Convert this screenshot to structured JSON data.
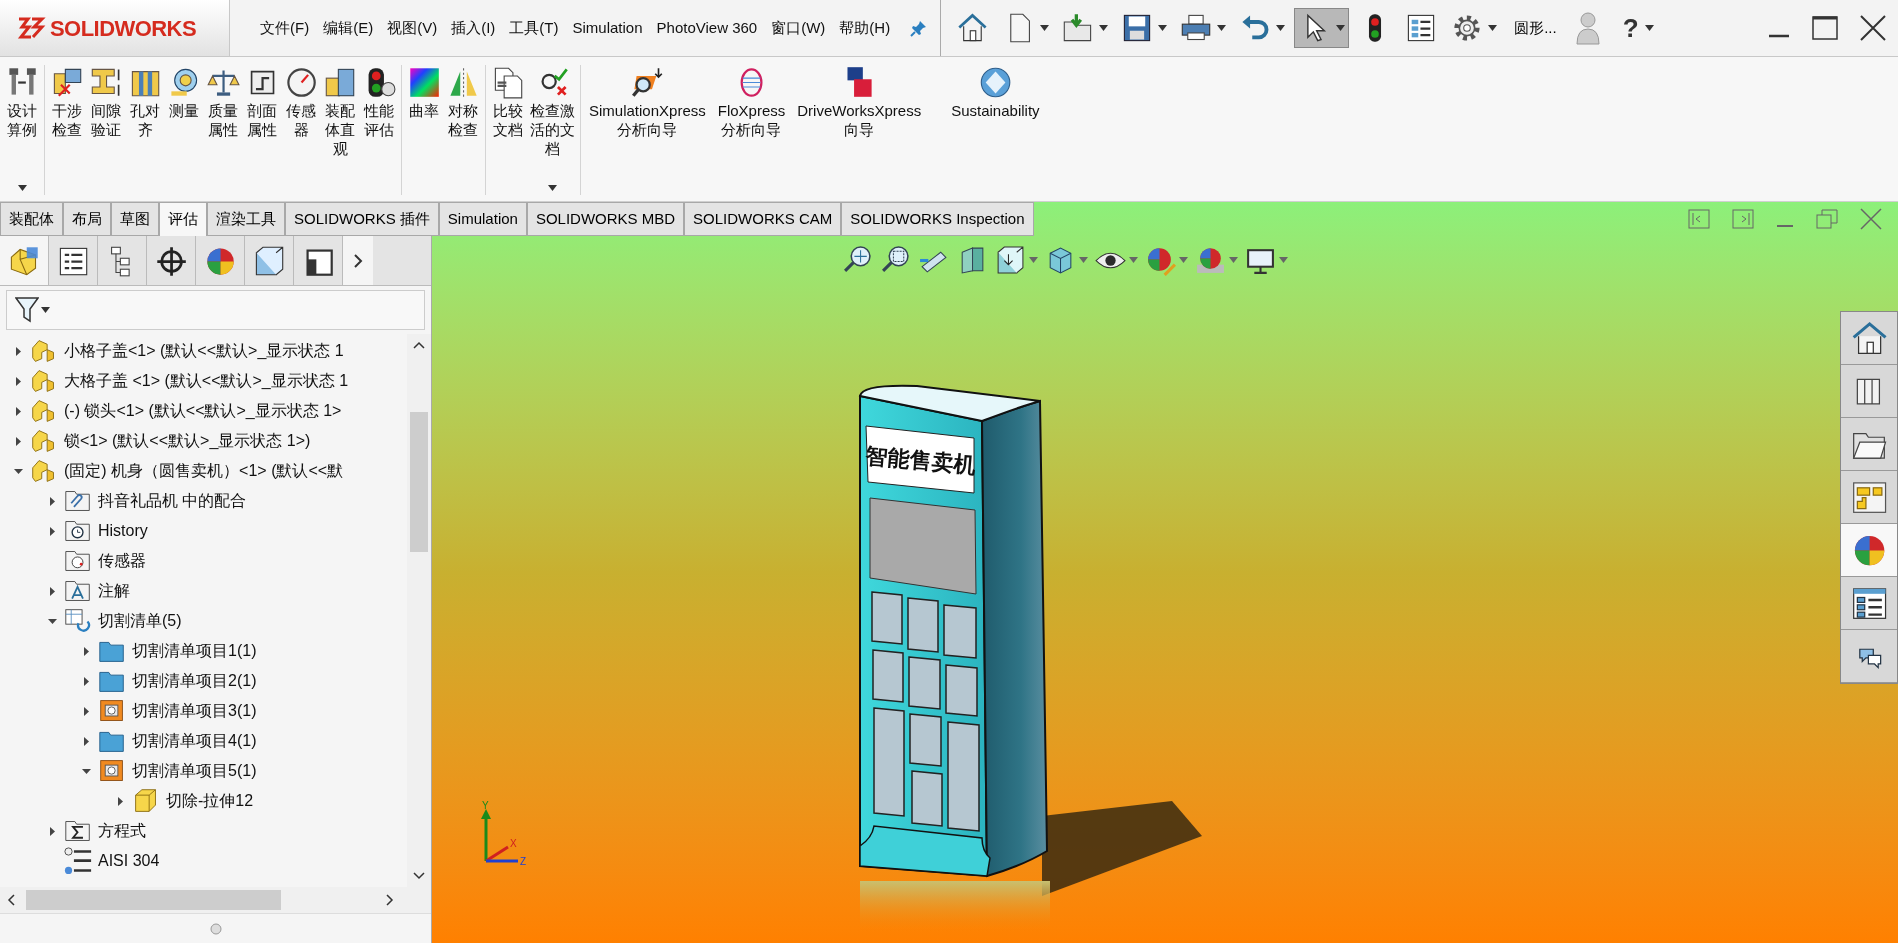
{
  "app": {
    "logo_text": "SOLIDWORKS"
  },
  "menu": [
    "文件(F)",
    "编辑(E)",
    "视图(V)",
    "插入(I)",
    "工具(T)",
    "Simulation",
    "PhotoView 360",
    "窗口(W)",
    "帮助(H)"
  ],
  "quick_tools": [
    {
      "kind": "home"
    },
    {
      "kind": "new",
      "dropdown": true
    },
    {
      "kind": "open",
      "dropdown": true
    },
    {
      "kind": "save",
      "dropdown": true
    },
    {
      "kind": "print",
      "dropdown": true
    },
    {
      "kind": "undo",
      "dropdown": true
    },
    {
      "kind": "select",
      "dropdown": true,
      "pressed": true
    },
    {
      "kind": "rebuild"
    },
    {
      "kind": "list"
    },
    {
      "kind": "options",
      "dropdown": true
    }
  ],
  "search_label": "圆形...",
  "help_label": "?",
  "ribbon_groups": [
    {
      "buttons": [
        {
          "label": "设计算例",
          "kind": "narrow",
          "dropdown": true
        }
      ]
    },
    {
      "buttons": [
        {
          "label": "干涉检查",
          "kind": "narrow"
        },
        {
          "label": "间隙验证",
          "kind": "narrow"
        },
        {
          "label": "孔对齐",
          "kind": "narrow"
        },
        {
          "label": "测量",
          "kind": "narrow"
        },
        {
          "label": "质量属性",
          "kind": "narrow"
        },
        {
          "label": "剖面属性",
          "kind": "narrow"
        },
        {
          "label": "传感器",
          "kind": "narrow"
        },
        {
          "label": "装配体直观",
          "kind": "narrow"
        },
        {
          "label": "性能评估",
          "kind": "narrow"
        }
      ]
    },
    {
      "buttons": [
        {
          "label": "曲率",
          "kind": "narrow"
        },
        {
          "label": "对称检查",
          "kind": "narrow"
        }
      ]
    },
    {
      "buttons": [
        {
          "label": "比较文档",
          "kind": "narrow"
        },
        {
          "label": "检查激活的文档",
          "kind": "wide",
          "dropdown": true
        }
      ]
    },
    {
      "buttons": [
        {
          "label": "SimulationXpress分析向导",
          "kind": "latin"
        },
        {
          "label": "FloXpress分析向导",
          "kind": "latin"
        },
        {
          "label": "DriveWorksXpress向导",
          "kind": "latin"
        },
        {
          "label": "Sustainability",
          "kind": "latin"
        }
      ]
    }
  ],
  "tabs": [
    {
      "label": "装配体",
      "selected": false
    },
    {
      "label": "布局",
      "selected": false
    },
    {
      "label": "草图",
      "selected": false
    },
    {
      "label": "评估",
      "selected": true
    },
    {
      "label": "渲染工具",
      "selected": false
    },
    {
      "label": "SOLIDWORKS 插件",
      "selected": false
    },
    {
      "label": "Simulation",
      "selected": false
    },
    {
      "label": "SOLIDWORKS MBD",
      "selected": false
    },
    {
      "label": "SOLIDWORKS CAM",
      "selected": false
    },
    {
      "label": "SOLIDWORKS Inspection",
      "selected": false
    }
  ],
  "panel_tabs": [
    {
      "selected": true
    },
    {
      "selected": false
    },
    {
      "selected": false
    },
    {
      "selected": false
    },
    {
      "selected": false
    },
    {
      "selected": false
    },
    {
      "selected": false
    }
  ],
  "tree": [
    {
      "label": "小格子盖<1> (默认<<默认>_显示状态 1",
      "kind": "part",
      "expanded": false
    },
    {
      "label": "大格子盖 <1> (默认<<默认>_显示状态 1",
      "kind": "part",
      "expanded": false
    },
    {
      "label": "(-) 锁头<1> (默认<<默认>_显示状态 1>",
      "kind": "part",
      "expanded": false
    },
    {
      "label": "锁<1> (默认<<默认>_显示状态 1>)",
      "kind": "part",
      "expanded": false
    },
    {
      "label": "(固定) 机身（圆售卖机）<1> (默认<<默",
      "kind": "part",
      "expanded": true,
      "children": [
        {
          "label": "抖音礼品机 中的配合",
          "kind": "mates",
          "expanded": false
        },
        {
          "label": "History",
          "kind": "history",
          "expanded": false
        },
        {
          "label": "传感器",
          "kind": "sensor"
        },
        {
          "label": "注解",
          "kind": "annotation",
          "expanded": false
        },
        {
          "label": "切割清单(5)",
          "kind": "cutlist",
          "expanded": true,
          "children": [
            {
              "label": "切割清单项目1(1)",
              "kind": "folder",
              "expanded": false
            },
            {
              "label": "切割清单项目2(1)",
              "kind": "folder",
              "expanded": false
            },
            {
              "label": "切割清单项目3(1)",
              "kind": "weldment",
              "expanded": false
            },
            {
              "label": "切割清单项目4(1)",
              "kind": "folder",
              "expanded": false
            },
            {
              "label": "切割清单项目5(1)",
              "kind": "weldment",
              "expanded": true,
              "children": [
                {
                  "label": "切除-拉伸12",
                  "kind": "feature",
                  "expanded": false
                }
              ]
            }
          ]
        },
        {
          "label": "方程式",
          "kind": "equations",
          "expanded": false
        },
        {
          "label": "AISI 304",
          "kind": "material"
        }
      ]
    }
  ],
  "model": {
    "sign_text": "智能售卖机"
  },
  "triad": {
    "labels": [
      "Y",
      "X",
      "Z"
    ]
  },
  "task_pane": [
    {
      "selected": false
    },
    {
      "selected": false
    },
    {
      "selected": false
    },
    {
      "selected": false
    },
    {
      "selected": true
    },
    {
      "selected": false
    },
    {
      "selected": false
    }
  ]
}
